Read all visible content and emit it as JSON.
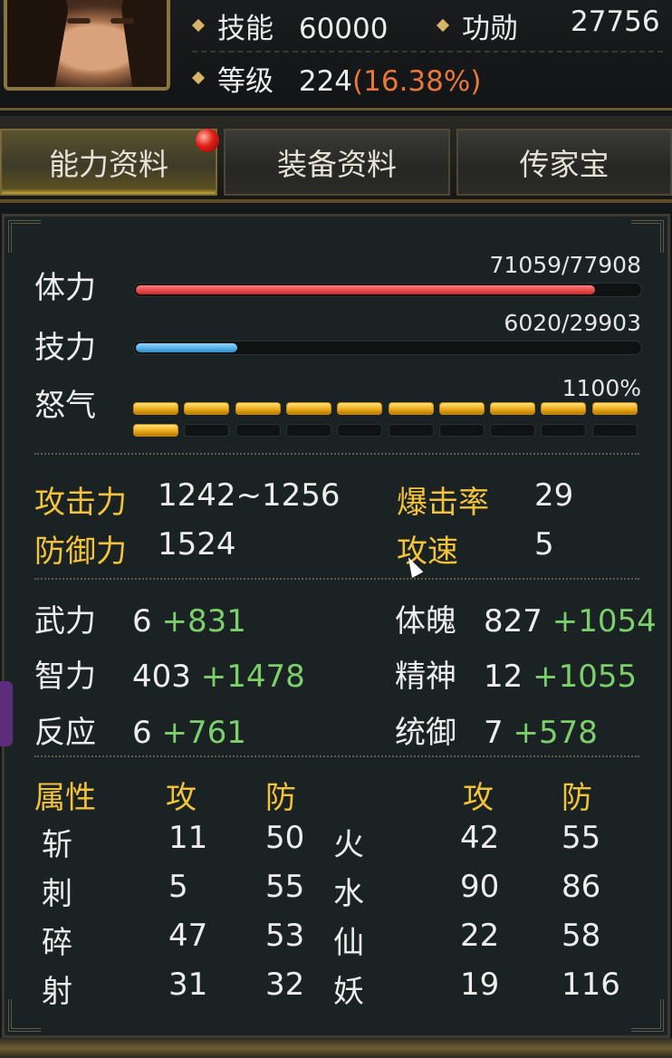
{
  "header": {
    "skill_label": "技能",
    "skill_value": "60000",
    "merit_label": "功勋",
    "merit_value": "27756",
    "level_label": "等级",
    "level_value": "224",
    "level_progress": "(16.38%)"
  },
  "tabs": [
    {
      "label": "能力资料",
      "active": true,
      "has_notification": true
    },
    {
      "label": "装备资料",
      "active": false
    },
    {
      "label": "传家宝",
      "active": false
    }
  ],
  "bars": {
    "hp": {
      "label": "体力",
      "value": "71059/77908",
      "current": 71059,
      "max": 77908
    },
    "mp": {
      "label": "技力",
      "value": "6020/29903",
      "current": 6020,
      "max": 29903
    },
    "rage": {
      "label": "怒气",
      "value": "1100%",
      "segments_total": 20,
      "segments_filled": 11
    }
  },
  "combat": {
    "attack_label": "攻击力",
    "attack_value": "1242~1256",
    "defense_label": "防御力",
    "defense_value": "1524",
    "crit_label": "爆击率",
    "crit_value": "29",
    "speed_label": "攻速",
    "speed_value": "5"
  },
  "stats": [
    {
      "label": "武力",
      "base": "6",
      "bonus": "+831"
    },
    {
      "label": "智力",
      "base": "403",
      "bonus": "+1478"
    },
    {
      "label": "反应",
      "base": "6",
      "bonus": "+761"
    },
    {
      "label": "体魄",
      "base": "827",
      "bonus": "+1054"
    },
    {
      "label": "精神",
      "base": "12",
      "bonus": "+1055"
    },
    {
      "label": "统御",
      "base": "7",
      "bonus": "+578"
    }
  ],
  "attributes": {
    "header_label": "属性",
    "atk_header": "攻",
    "def_header": "防",
    "left": [
      {
        "name": "斩",
        "atk": "11",
        "def": "50"
      },
      {
        "name": "刺",
        "atk": "5",
        "def": "55"
      },
      {
        "name": "碎",
        "atk": "47",
        "def": "53"
      },
      {
        "name": "射",
        "atk": "31",
        "def": "32"
      }
    ],
    "right": [
      {
        "name": "火",
        "atk": "42",
        "def": "55"
      },
      {
        "name": "水",
        "atk": "90",
        "def": "86"
      },
      {
        "name": "仙",
        "atk": "22",
        "def": "58"
      },
      {
        "name": "妖",
        "atk": "19",
        "def": "116"
      }
    ]
  },
  "colors": {
    "gold": "#f3c33a",
    "green": "#7ccf6b",
    "hp": "#d12a2a",
    "mp": "#2b8fd0",
    "rage": "#e9a715",
    "progress": "#e7773d"
  }
}
